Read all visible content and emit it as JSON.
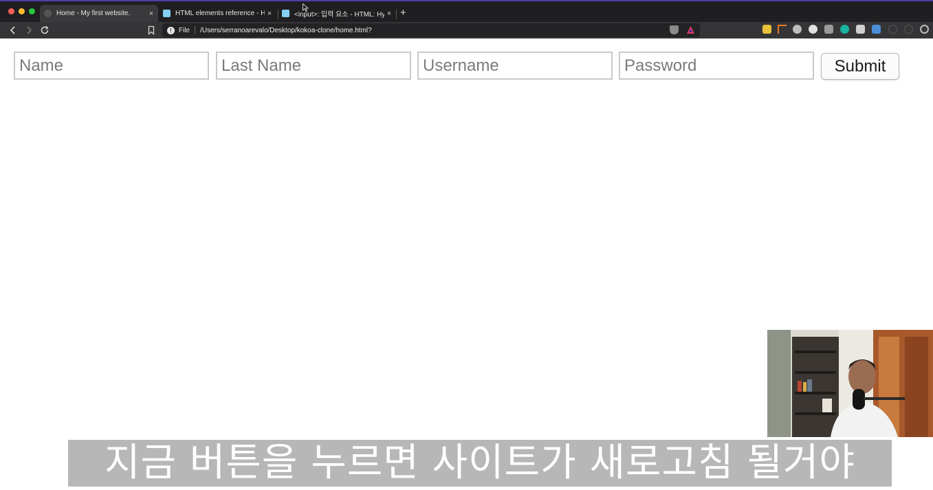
{
  "browser": {
    "tabs": [
      {
        "title": "Home - My first website.",
        "active": true
      },
      {
        "title": "HTML elements reference - HTML",
        "active": false
      },
      {
        "title": "<input>: 입력 요소 - HTML: Hypertext",
        "active": false
      }
    ],
    "tab_close_glyph": "×",
    "new_tab_glyph": "+",
    "address_bar": {
      "scheme_label": "File",
      "url": "/Users/serranoarevalo/Desktop/kokoa-clone/home.html?"
    },
    "icons": [
      "back-icon",
      "forward-icon",
      "reload-icon",
      "bookmark-icon",
      "info-icon",
      "brave-shield-icon",
      "brave-rewards-icon"
    ]
  },
  "form": {
    "name_placeholder": "Name",
    "last_name_placeholder": "Last Name",
    "username_placeholder": "Username",
    "password_placeholder": "Password",
    "submit_label": "Submit"
  },
  "subtitle": "지금 버튼을 누르면 사이트가 새로고침 될거야",
  "colors": {
    "tabstrip": "#1f1f21",
    "toolbar": "#353538",
    "field_border": "#c9c9c9",
    "subtitle_bg": "#b7b7b7"
  }
}
